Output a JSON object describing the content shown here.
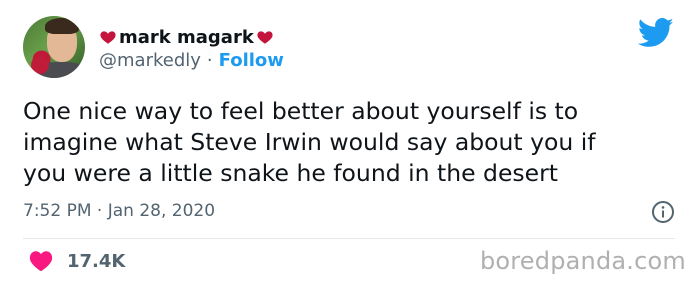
{
  "tweet": {
    "author": {
      "display_name": "mark magark",
      "handle": "@markedly",
      "separator": "·",
      "follow_label": "Follow"
    },
    "text": "One nice way to feel better about yourself is to\nimagine what Steve Irwin would say about you if\nyou were a little snake he found in the desert",
    "timestamp": "7:52 PM · Jan 28, 2020",
    "likes": "17.4K"
  },
  "icons": {
    "name_decoration": "heart-icon",
    "brand": "twitter-bird-icon",
    "info": "info-icon",
    "like": "heart-icon"
  },
  "colors": {
    "heart_small": "#c4133c",
    "like_heart": "#f91880",
    "follow": "#1d9bf0",
    "brand": "#1d9bf0"
  },
  "watermark": "boredpanda.com"
}
